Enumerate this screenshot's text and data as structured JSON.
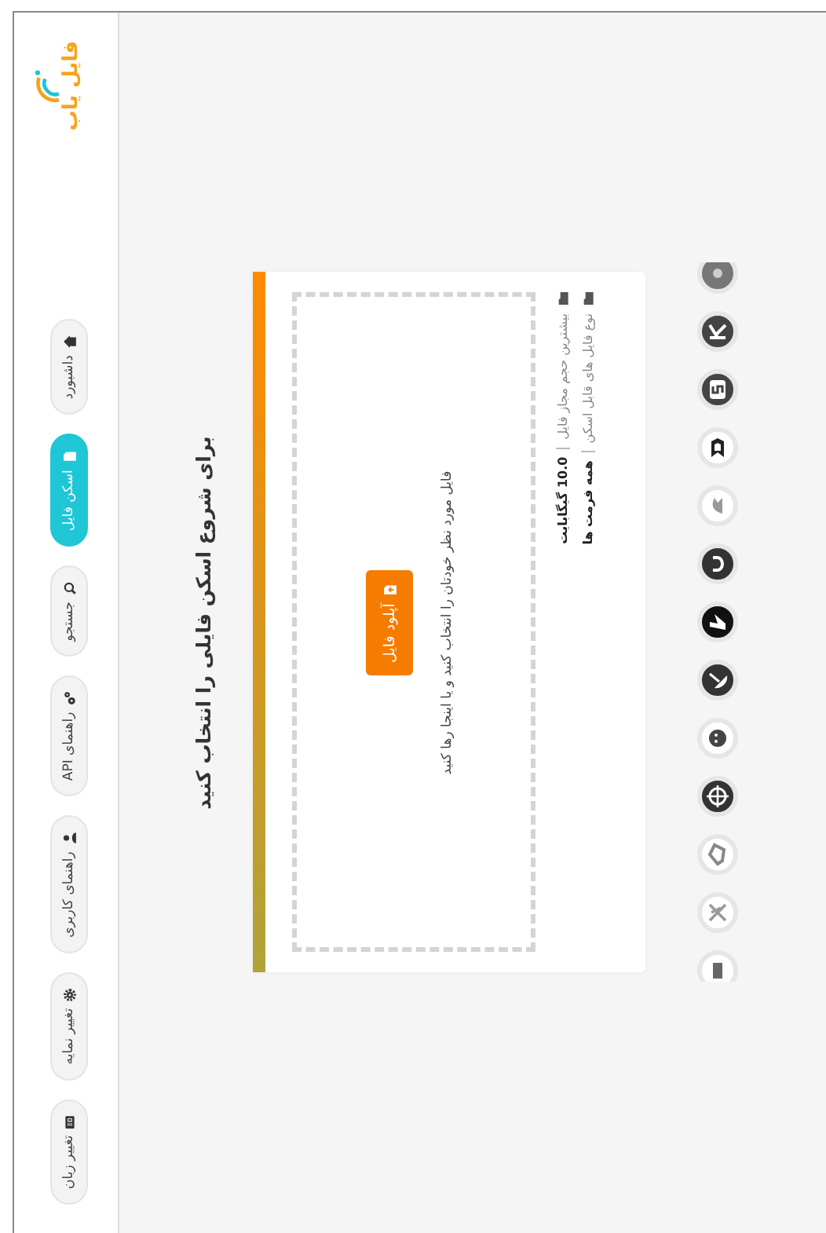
{
  "logo": {
    "text": "فایل یاب"
  },
  "nav": [
    {
      "label": "داشبورد",
      "selected": false
    },
    {
      "label": "اسکن فایل",
      "selected": true
    },
    {
      "label": "جستجو",
      "selected": false
    },
    {
      "label": "راهنمای API",
      "selected": false
    },
    {
      "label": "راهنمای کاربری",
      "selected": false
    },
    {
      "label": "تغییر نمایه",
      "selected": false
    },
    {
      "label": "تغییر زبان",
      "selected": false
    }
  ],
  "page_title": "برای شروع اسکن فایلی را انتخاب کنید",
  "upload": {
    "button": "آپلود فایل",
    "hint": "فایل مورد نظر خودتان را انتخاب کنید و یا اینجا رها کنید"
  },
  "limits": [
    {
      "label": "بیشترین حجم مجاز فایل",
      "value": "10.0 گیگابایت"
    },
    {
      "label": "نوع فایل های قابل اسکن",
      "value": "همه فرمت ها"
    }
  ]
}
